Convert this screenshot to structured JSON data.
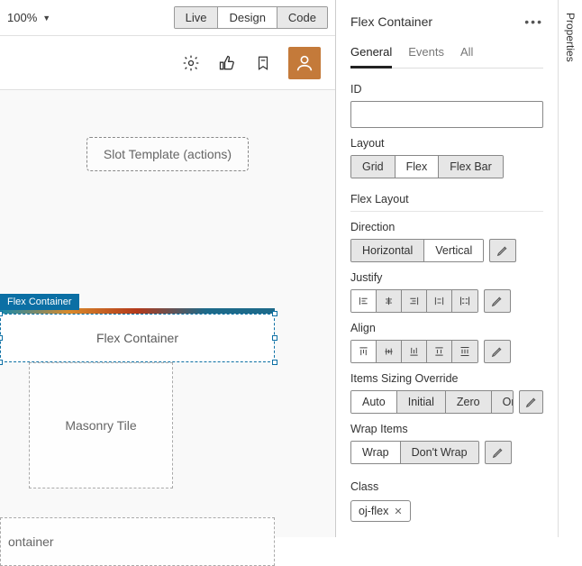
{
  "toolbar": {
    "zoom": "100%",
    "modes": {
      "live": "Live",
      "design": "Design",
      "code": "Code",
      "selected": "design"
    }
  },
  "canvas": {
    "slot_template_label": "Slot Template (actions)",
    "selection_tag": "Flex Container",
    "flex_container_label": "Flex Container",
    "masonry_label": "Masonry Tile",
    "lower_container_label": "ontainer"
  },
  "panel": {
    "title": "Flex Container",
    "tabs": {
      "general": "General",
      "events": "Events",
      "all": "All",
      "active": "general"
    },
    "id_label": "ID",
    "id_value": "",
    "layout": {
      "label": "Layout",
      "options": {
        "grid": "Grid",
        "flex": "Flex",
        "flexbar": "Flex Bar"
      },
      "selected": "flex"
    },
    "flex_layout_heading": "Flex Layout",
    "direction": {
      "label": "Direction",
      "options": {
        "horizontal": "Horizontal",
        "vertical": "Vertical"
      },
      "selected": "vertical"
    },
    "justify_label": "Justify",
    "align_label": "Align",
    "sizing": {
      "label": "Items Sizing Override",
      "options": {
        "auto": "Auto",
        "initial": "Initial",
        "zero": "Zero",
        "one": "One"
      },
      "selected": "auto"
    },
    "wrap": {
      "label": "Wrap Items",
      "options": {
        "wrap": "Wrap",
        "dont": "Don't Wrap"
      },
      "selected": "wrap"
    },
    "class": {
      "label": "Class",
      "chip": "oj-flex"
    }
  },
  "side_tab": {
    "label": "Properties"
  }
}
